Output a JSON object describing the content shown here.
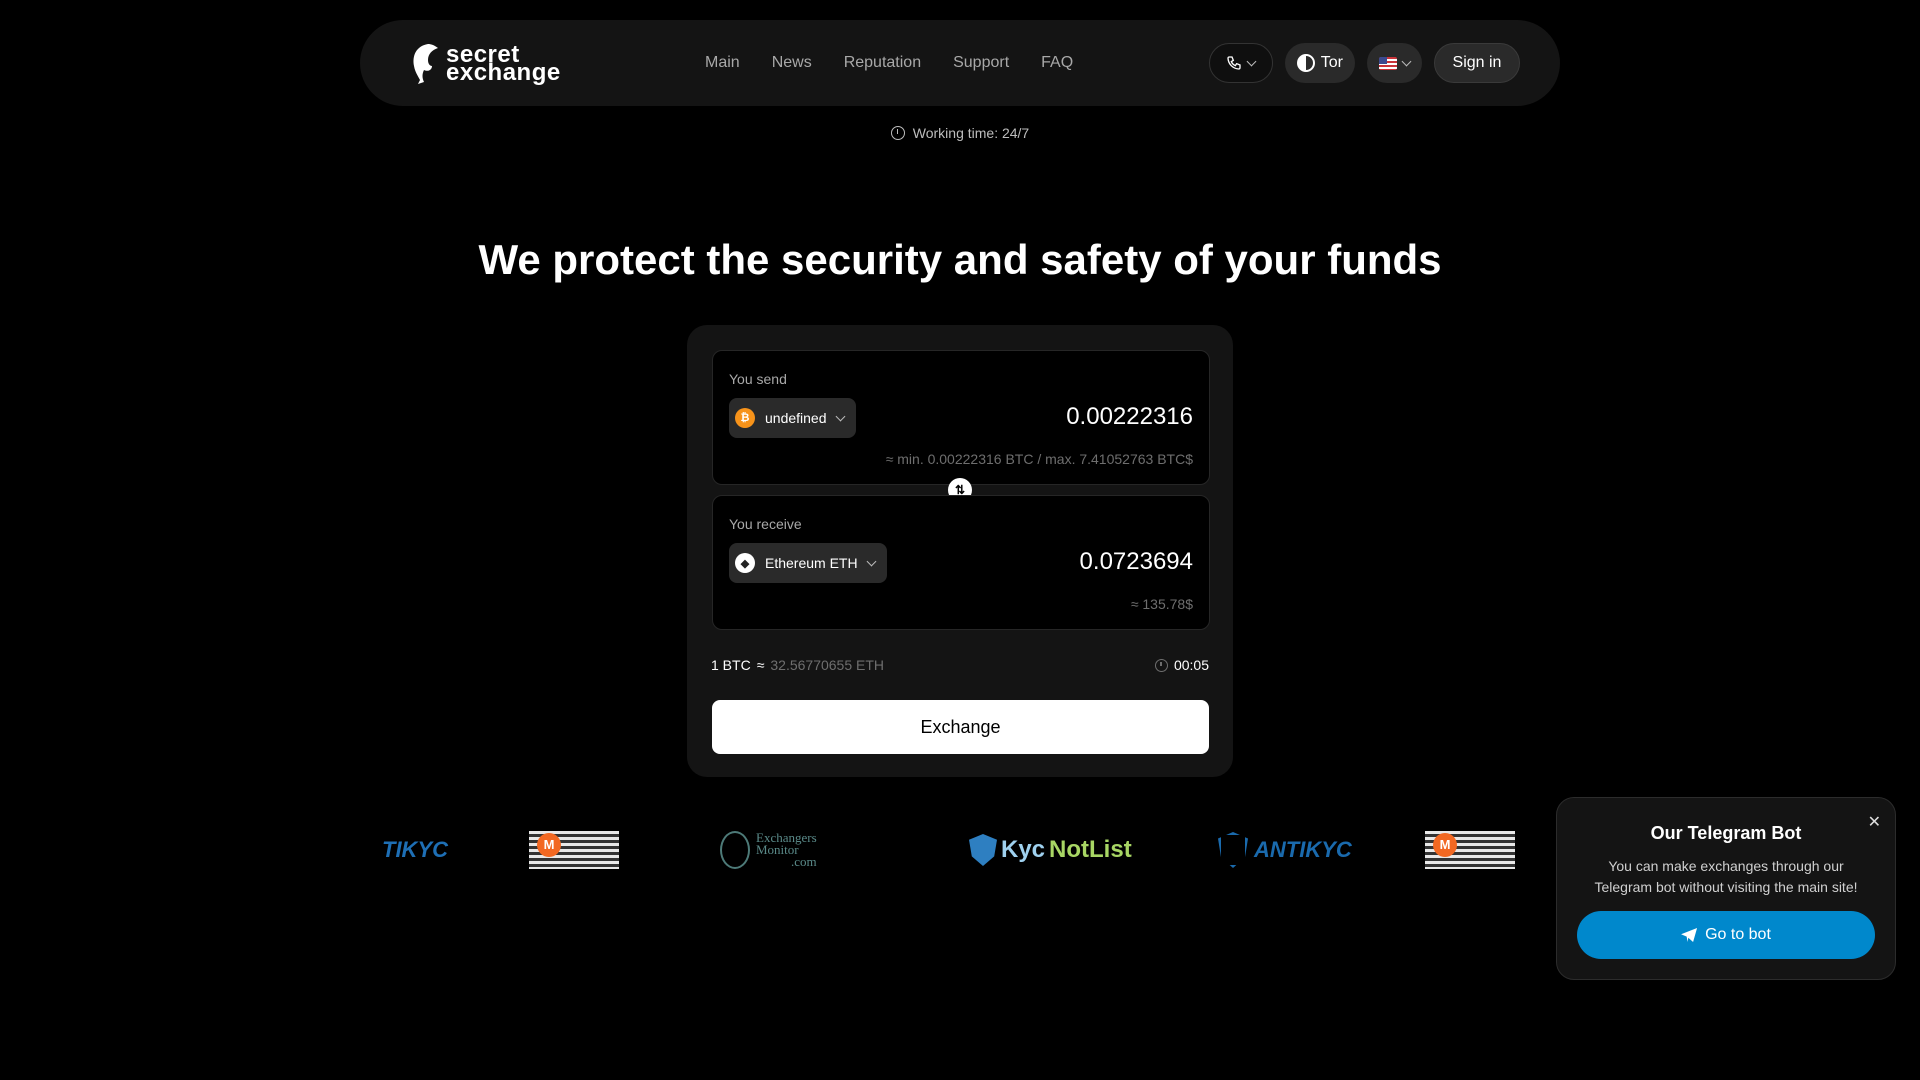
{
  "brand": {
    "line1": "secret",
    "line2": "exchange"
  },
  "nav": {
    "main": "Main",
    "news": "News",
    "reputation": "Reputation",
    "support": "Support",
    "faq": "FAQ"
  },
  "header": {
    "tor_label": "Tor",
    "signin_label": "Sign in",
    "language": "en-US"
  },
  "working_time": "Working time: 24/7",
  "headline": "We protect the security and safety of your funds",
  "send": {
    "label": "You send",
    "coin": "undefined",
    "coin_icon": "bitcoin-icon",
    "amount": "0.00222316",
    "limits": "≈ min. 0.00222316 BTC / max. 7.41052763 BTC$"
  },
  "receive": {
    "label": "You receive",
    "coin": "Ethereum ETH",
    "coin_icon": "ethereum-icon",
    "amount": "0.0723694",
    "usd": "≈ 135.78$"
  },
  "rate": {
    "base": "1 BTC",
    "approx": "≈",
    "quote": "32.56770655 ETH"
  },
  "timer": "00:05",
  "exchange_button": "Exchange",
  "partners": {
    "tikyc": "TIKYC",
    "exmon_line1": "Exchangers",
    "exmon_line2": "Monitor",
    "exmon_line3": ".com",
    "kyc_a": "Kyc",
    "kyc_b": "NotList",
    "antikyc": "ANTIKYC"
  },
  "telegram": {
    "title": "Our Telegram Bot",
    "text": "You can make exchanges through our Telegram bot without visiting the main site!",
    "button": "Go to bot",
    "color": "#0088cc"
  }
}
